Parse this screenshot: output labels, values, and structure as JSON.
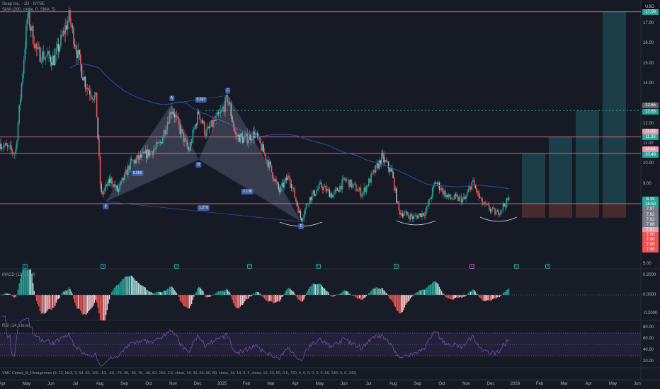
{
  "header": {
    "title": "Snap Inc. · 1D · NYSE",
    "sma": "SMA (200, close, 0, SMA, 5)"
  },
  "currency": "USD",
  "colors": {
    "up": "#26a69a",
    "down": "#ef5350",
    "sma": "#2f4fa8",
    "level": "#c76b87",
    "bg": "#161a25"
  },
  "price_axis": [
    "17.00",
    "16.00",
    "15.00",
    "14.00",
    "12.00",
    "11.00",
    "10.00",
    "9.00",
    "5.00"
  ],
  "price_axis_values": [
    17,
    16,
    15,
    14,
    12,
    11,
    10,
    9,
    5
  ],
  "price_tags": [
    {
      "text": "17.58",
      "price": 17.58,
      "color": "#26a69a"
    },
    {
      "text": "12.65",
      "price": 12.9,
      "color": "#5d6b73"
    },
    {
      "text": "12.65",
      "price": 12.6,
      "color": "#26a69a"
    },
    {
      "text": "11.33",
      "price": 11.6,
      "color": "#e79aa8"
    },
    {
      "text": "11.33",
      "price": 11.3,
      "color": "#26a69a"
    },
    {
      "text": "10.51",
      "price": 10.72,
      "color": "#e79aa8"
    },
    {
      "text": "10.48",
      "price": 10.43,
      "color": "#26a69a"
    },
    {
      "text": "8.19",
      "price": 8.22,
      "color": "#26a69a"
    },
    {
      "text": "16:50",
      "price": 7.97,
      "color": "#26a69a"
    },
    {
      "text": "7.97",
      "price": 7.7,
      "color": "#787b86"
    },
    {
      "text": "7.92",
      "price": 7.45,
      "color": "#787b86"
    },
    {
      "text": "7.92",
      "price": 7.2,
      "color": "#787b86"
    },
    {
      "text": "7.88",
      "price": 6.95,
      "color": "#787b86"
    },
    {
      "text": "7.91",
      "price": 6.7,
      "color": "#e79aa8"
    },
    {
      "text": "7.00",
      "price": 6.45,
      "color": "#ef5350"
    },
    {
      "text": "7.00",
      "price": 6.2,
      "color": "#ef5350"
    },
    {
      "text": "7.00",
      "price": 5.95,
      "color": "#ef5350"
    },
    {
      "text": "7.00",
      "price": 5.7,
      "color": "#ef5350"
    }
  ],
  "levels": [
    17.58,
    11.33,
    10.51,
    8.0
  ],
  "dotted_level": 12.65,
  "months": [
    "Apr",
    "May",
    "Jun",
    "Jul",
    "Aug",
    "Sep",
    "Oct",
    "Nov",
    "Dec",
    "2025",
    "Feb",
    "Mar",
    "Apr",
    "May",
    "Jun",
    "Jul",
    "Aug",
    "Sep",
    "Oct",
    "Nov",
    "Dec",
    "2026",
    "Feb",
    "Mar",
    "Apr",
    "May",
    "Jun"
  ],
  "anchors": [
    [
      0,
      11
    ],
    [
      0.6,
      10.5
    ],
    [
      1.1,
      17.4
    ],
    [
      1.5,
      15.5
    ],
    [
      2.2,
      15.2
    ],
    [
      2.8,
      17.3
    ],
    [
      3.3,
      14.7
    ],
    [
      3.5,
      13.9
    ],
    [
      3.9,
      13.2
    ],
    [
      4.1,
      8.4
    ],
    [
      4.5,
      9.2
    ],
    [
      4.8,
      8.6
    ],
    [
      5.3,
      10.0
    ],
    [
      6.0,
      10.5
    ],
    [
      6.5,
      10.9
    ],
    [
      7.0,
      12.8
    ],
    [
      7.4,
      11.5
    ],
    [
      7.7,
      10.6
    ],
    [
      8.1,
      12.6
    ],
    [
      8.4,
      11.5
    ],
    [
      9.0,
      12.5
    ],
    [
      9.3,
      13.3
    ],
    [
      9.6,
      11.4
    ],
    [
      10.0,
      11.2
    ],
    [
      10.4,
      11.5
    ],
    [
      10.9,
      10.2
    ],
    [
      11.4,
      8.6
    ],
    [
      11.8,
      9.4
    ],
    [
      12.3,
      7.2
    ],
    [
      12.6,
      8.2
    ],
    [
      13.1,
      8.9
    ],
    [
      13.6,
      8.4
    ],
    [
      14.1,
      9.2
    ],
    [
      14.8,
      8.5
    ],
    [
      15.3,
      9.6
    ],
    [
      15.6,
      10.3
    ],
    [
      16.0,
      9.6
    ],
    [
      16.3,
      7.6
    ],
    [
      16.9,
      7.3
    ],
    [
      17.4,
      7.6
    ],
    [
      17.8,
      9.1
    ],
    [
      18.3,
      8.3
    ],
    [
      19.0,
      8.2
    ],
    [
      19.3,
      9.1
    ],
    [
      19.7,
      8.0
    ],
    [
      20.3,
      7.5
    ],
    [
      20.8,
      8.2
    ]
  ],
  "pattern": {
    "points": [
      {
        "label": "X",
        "t": 4.3,
        "p": 8.1
      },
      {
        "label": "A",
        "t": 7.0,
        "p": 13.0
      },
      {
        "label": "B",
        "t": 8.1,
        "p": 10.2
      },
      {
        "label": "C",
        "t": 9.3,
        "p": 13.4
      },
      {
        "label": "D",
        "t": 12.3,
        "p": 7.1
      }
    ],
    "ratios": [
      {
        "text": "0.560",
        "t": 5.6,
        "p": 9.5
      },
      {
        "text": "0.607",
        "t": 8.2,
        "p": 13.2
      },
      {
        "text": "2.138",
        "t": 10.1,
        "p": 8.6
      },
      {
        "text": "1.279",
        "t": 8.3,
        "p": 7.8
      }
    ]
  },
  "projection": {
    "base": 8.0,
    "stop": 7.3,
    "targets": [
      10.51,
      11.33,
      12.65,
      17.58
    ]
  },
  "events": [
    {
      "t": 0.9,
      "txt": "D"
    },
    {
      "t": 4.1,
      "txt": "E"
    },
    {
      "t": 7.1,
      "txt": "E"
    },
    {
      "t": 10.1,
      "txt": "E"
    },
    {
      "t": 12.9,
      "txt": "E"
    },
    {
      "t": 16.1,
      "txt": "E"
    },
    {
      "t": 19.2,
      "txt": "D"
    },
    {
      "t": 21.0,
      "txt": "E"
    },
    {
      "t": 22.3,
      "txt": "E"
    }
  ],
  "macd": {
    "title": "MACD (12, 26, 9)",
    "axis": [
      "0.2000",
      "0.0000",
      "-0.2000"
    ]
  },
  "rsi": {
    "title": "RSI (14, close)",
    "axis": [
      "80.00",
      "60.00",
      "40.00",
      "20.00"
    ]
  },
  "vmc": {
    "title": "VMC Cipher_B_Divergences (9, 12, hlc3, 3, 53, 60, 100, -53, -60, -75, 45, -65, 15, -40, 60, 150, 2.5, close, 14, 30, 60, 60, 80, close, 14, 14, 3, 3, close, 10, 23, 50, 0.5, 720, 0, 0, 0, 0, 0, 0, 60, 240, 0, 0, 240)"
  }
}
